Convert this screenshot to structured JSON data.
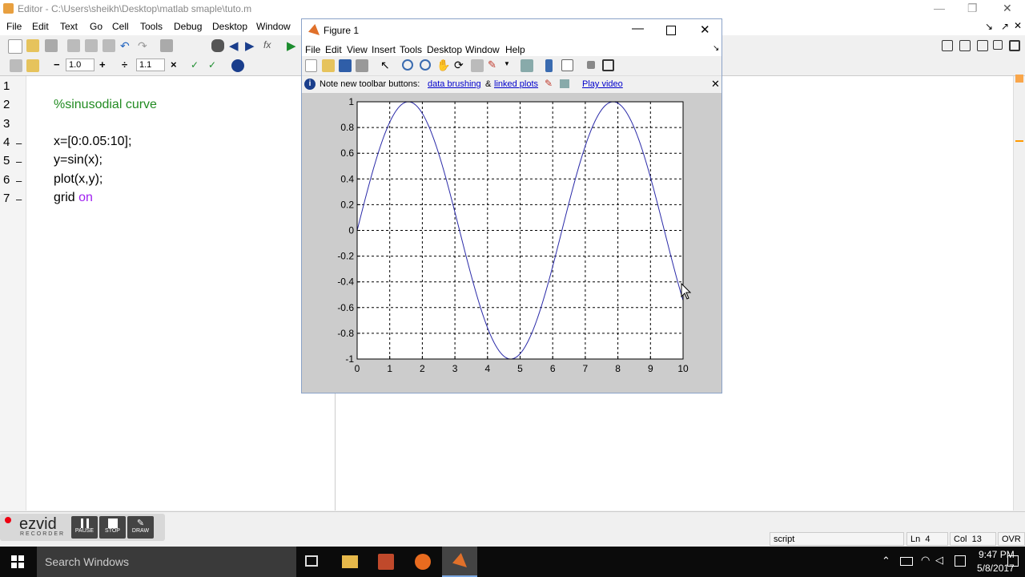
{
  "editor": {
    "title": "Editor - C:\\Users\\sheikh\\Desktop\\matlab smaple\\tuto.m",
    "menu": [
      "File",
      "Edit",
      "Text",
      "Go",
      "Cell",
      "Tools",
      "Debug",
      "Desktop",
      "Window"
    ],
    "toolbar": {
      "minus": "−",
      "value1": "1.0",
      "plus": "+",
      "divide": "÷",
      "value2": "1.1",
      "close": "×"
    },
    "line_numbers": [
      "1",
      "2",
      "3",
      "4",
      "5",
      "6",
      "7"
    ],
    "lines": [
      {
        "text": "",
        "type": "blank"
      },
      {
        "text": "%sinusodial curve",
        "type": "comment"
      },
      {
        "text": "",
        "type": "blank"
      },
      {
        "text": "x=[0:0.05:10];",
        "type": "code",
        "marker": "–"
      },
      {
        "text": "y=sin(x);",
        "type": "code",
        "marker": "–"
      },
      {
        "text": "plot(x,y);",
        "type": "code",
        "marker": "–"
      },
      {
        "text": "grid ",
        "keyword": "on",
        "type": "code",
        "marker": "–"
      }
    ]
  },
  "statusbar": {
    "mode": "script",
    "ln_label": "Ln",
    "ln": "4",
    "col_label": "Col",
    "col": "13",
    "ovr": "OVR"
  },
  "ezvid": {
    "logo": "ezvid",
    "sub": "RECORDER",
    "pause": "PAUSE",
    "stop": "STOP",
    "draw": "DRAW"
  },
  "taskbar": {
    "search": "Search Windows",
    "time": "9:47 PM",
    "date": "5/8/2017"
  },
  "figure": {
    "title": "Figure 1",
    "menu": [
      "File",
      "Edit",
      "View",
      "Insert",
      "Tools",
      "Desktop",
      "Window",
      "Help"
    ],
    "note": {
      "prefix": "Note new toolbar buttons:",
      "link1": "data brushing",
      "amp": "&",
      "link2": "linked plots",
      "link3": "Play video"
    }
  },
  "chart_data": {
    "type": "line",
    "function": "y = sin(x)",
    "x_start": 0,
    "x_end": 10,
    "x_step": 0.05,
    "xlim": [
      0,
      10
    ],
    "ylim": [
      -1,
      1
    ],
    "xticks": [
      "0",
      "1",
      "2",
      "3",
      "4",
      "5",
      "6",
      "7",
      "8",
      "9",
      "10"
    ],
    "yticks": [
      "1",
      "0.8",
      "0.6",
      "0.4",
      "0.2",
      "0",
      "-0.2",
      "-0.4",
      "-0.6",
      "-0.8",
      "-1"
    ],
    "grid": true,
    "line_color": "#2a2aa8",
    "title": "",
    "xlabel": "",
    "ylabel": ""
  },
  "colors": {
    "comment": "#228b22",
    "keyword": "#a020f0",
    "link": "#0000cc"
  }
}
